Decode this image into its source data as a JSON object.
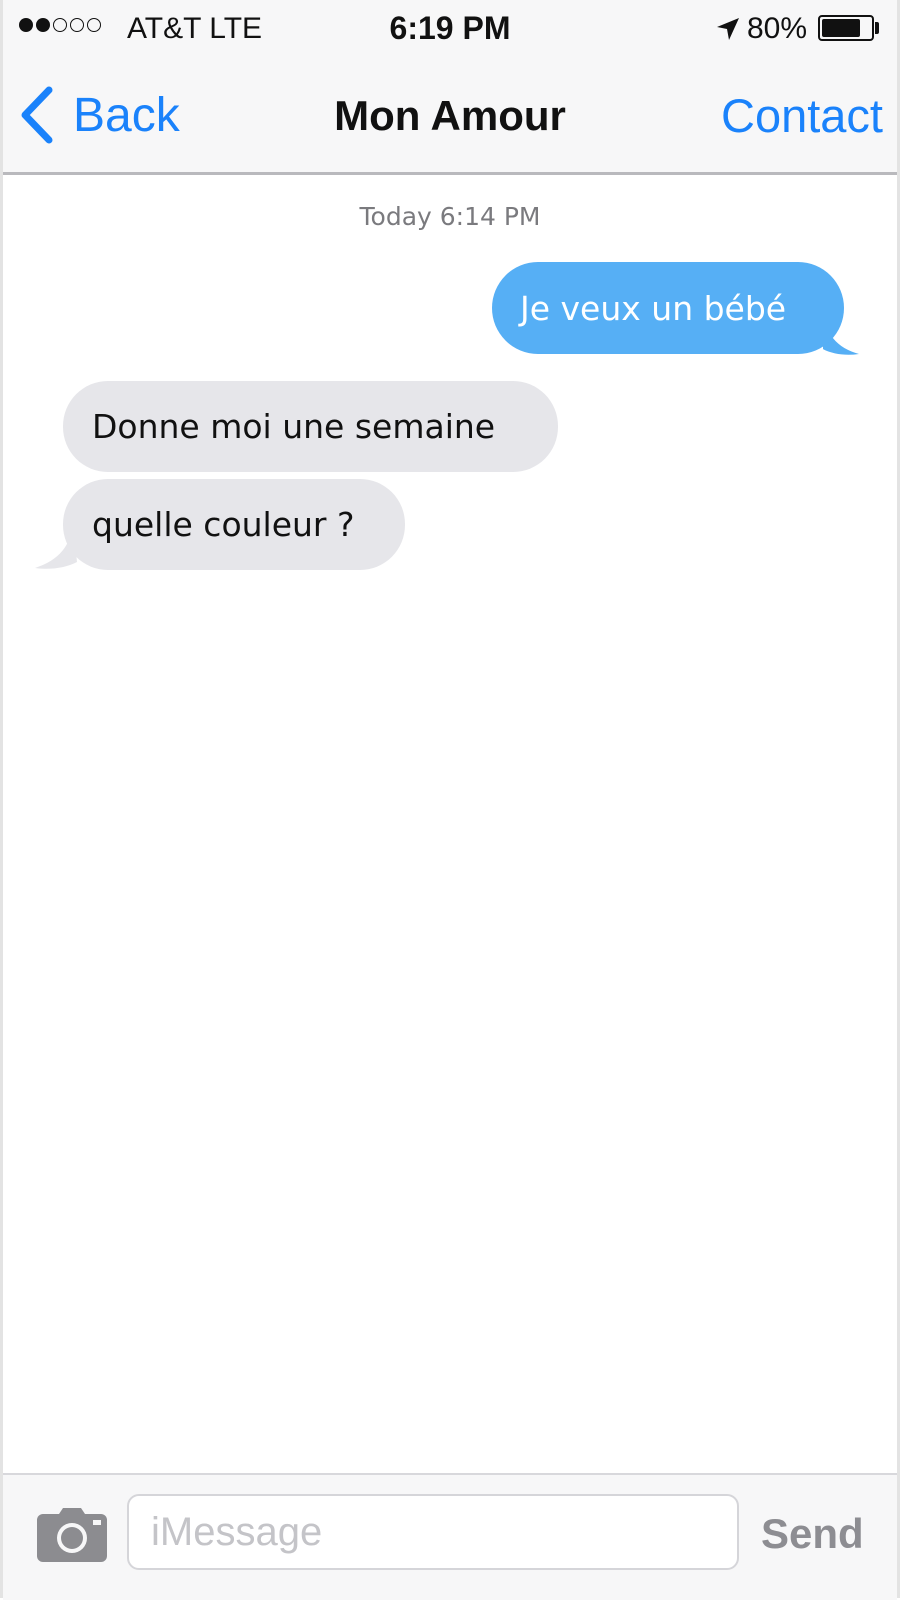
{
  "status_bar": {
    "signal_bars_filled": 2,
    "signal_bars_total": 5,
    "carrier": "AT&T LTE",
    "time": "6:19 PM",
    "location_icon": "location-arrow-icon",
    "battery_percent_label": "80%",
    "battery_level": 0.8
  },
  "nav": {
    "back_label": "Back",
    "title": "Mon Amour",
    "contact_label": "Contact",
    "accent_color": "#1a82fb"
  },
  "conversation": {
    "timestamp": "Today 6:14 PM",
    "messages": [
      {
        "direction": "sent",
        "text": "Je veux un bébé",
        "color": "#56aff5"
      },
      {
        "direction": "received",
        "text": "Donne moi une semaine",
        "color": "#e6e6ea"
      },
      {
        "direction": "received",
        "text": "quelle couleur ?",
        "color": "#e6e6ea"
      }
    ]
  },
  "composer": {
    "camera_icon": "camera-icon",
    "placeholder": "iMessage",
    "send_label": "Send"
  }
}
